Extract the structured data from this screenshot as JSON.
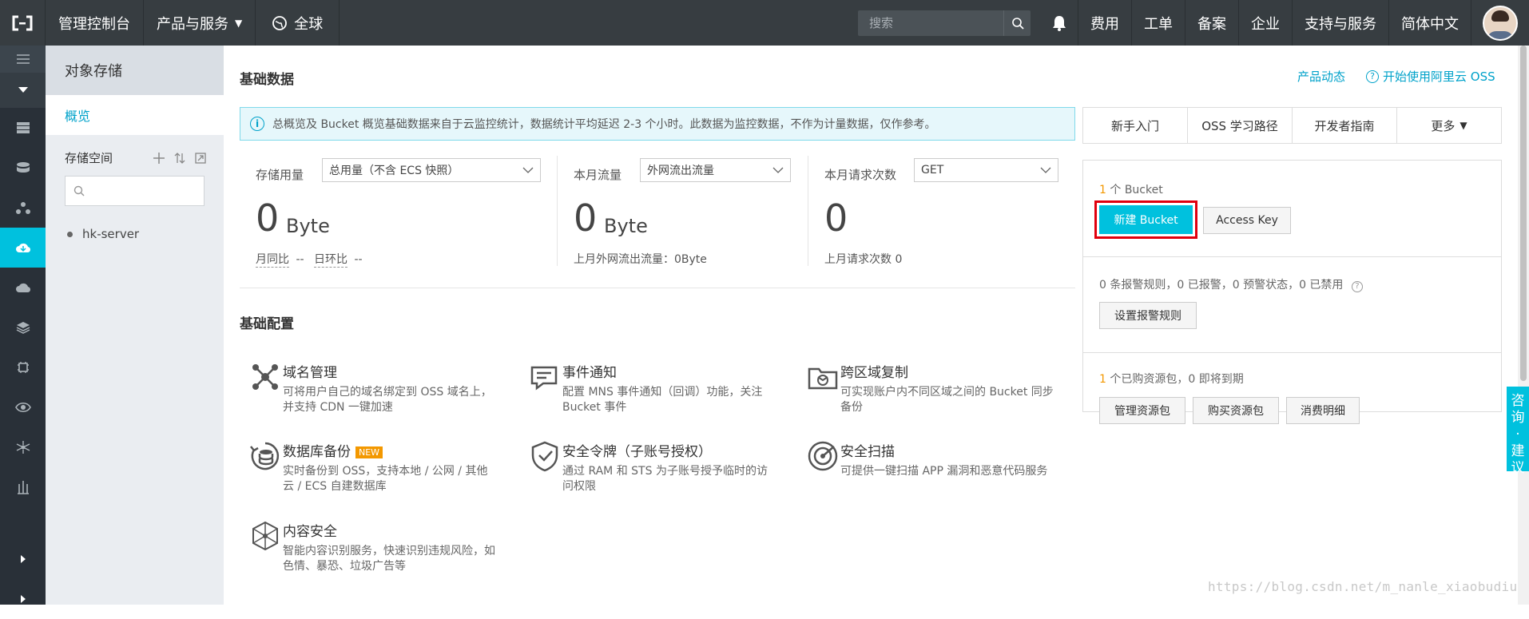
{
  "topbar": {
    "console": "管理控制台",
    "products": "产品与服务",
    "region": "全球",
    "search_placeholder": "搜索",
    "links": [
      "费用",
      "工单",
      "备案",
      "企业",
      "支持与服务",
      "简体中文"
    ]
  },
  "subnav": {
    "title": "对象存储",
    "overview": "概览",
    "storage_label": "存储空间",
    "buckets": [
      "hk-server"
    ]
  },
  "main": {
    "section_basic_data": "基础数据",
    "top_links": {
      "product_news": "产品动态",
      "getting_started": "开始使用阿里云 OSS"
    },
    "notice": "总概览及 Bucket 概览基础数据来自于云监控统计，数据统计平均延迟 2-3 个小时。此数据为监控数据，不作为计量数据，仅作参考。",
    "stats": [
      {
        "label": "存储用量",
        "select": "总用量（不含 ECS 快照）",
        "value": "0",
        "unit": "Byte",
        "sub1": "月同比",
        "sub1v": "--",
        "sub2": "日环比",
        "sub2v": "--"
      },
      {
        "label": "本月流量",
        "select": "外网流出流量",
        "value": "0",
        "unit": "Byte",
        "sub": "上月外网流出流量：0Byte"
      },
      {
        "label": "本月请求次数",
        "select": "GET",
        "value": "0",
        "sub": "上月请求次数 0"
      }
    ],
    "section_basic_config": "基础配置",
    "configs": [
      {
        "title": "域名管理",
        "desc": "可将用户自己的域名绑定到 OSS 域名上，并支持 CDN 一键加速",
        "icon": "domain-icon"
      },
      {
        "title": "事件通知",
        "desc": "配置 MNS 事件通知（回调）功能，关注 Bucket 事件",
        "icon": "event-icon"
      },
      {
        "title": "跨区域复制",
        "desc": "可实现账户内不同区域之间的 Bucket 同步备份",
        "icon": "replication-icon"
      },
      {
        "title": "数据库备份",
        "badge": "NEW",
        "desc": "实时备份到 OSS，支持本地 / 公网 / 其他云 / ECS 自建数据库",
        "icon": "db-backup-icon"
      },
      {
        "title": "安全令牌（子账号授权）",
        "desc": "通过 RAM 和 STS 为子账号授予临时的访问权限",
        "icon": "shield-icon"
      },
      {
        "title": "安全扫描",
        "desc": "可提供一键扫描 APP 漏洞和恶意代码服务",
        "icon": "scan-icon"
      },
      {
        "title": "内容安全",
        "desc": "智能内容识别服务，快速识别违规风险，如色情、暴恐、垃圾广告等",
        "icon": "content-security-icon"
      }
    ]
  },
  "right": {
    "tabs": [
      "新手入门",
      "OSS 学习路径",
      "开发者指南",
      "更多"
    ],
    "bucket_count": "1",
    "bucket_label": "个 Bucket",
    "new_bucket": "新建 Bucket",
    "access_key": "Access Key",
    "alarm_text": "0 条报警规则，0 已报警，0 预警状态，0 已禁用",
    "alarm_button": "设置报警规则",
    "pack_count": "1",
    "pack_text": "个已购资源包，0 即将到期",
    "pack_buttons": [
      "管理资源包",
      "购买资源包",
      "消费明细"
    ]
  },
  "float_feedback": [
    "咨",
    "询",
    "·",
    "建",
    "议"
  ],
  "watermark": "https://blog.csdn.net/m_nanle_xiaobudiu",
  "colors": {
    "topbar": "#373d41",
    "accent": "#00c1de",
    "link": "#00a2ca",
    "highlight": "#e0000e"
  }
}
